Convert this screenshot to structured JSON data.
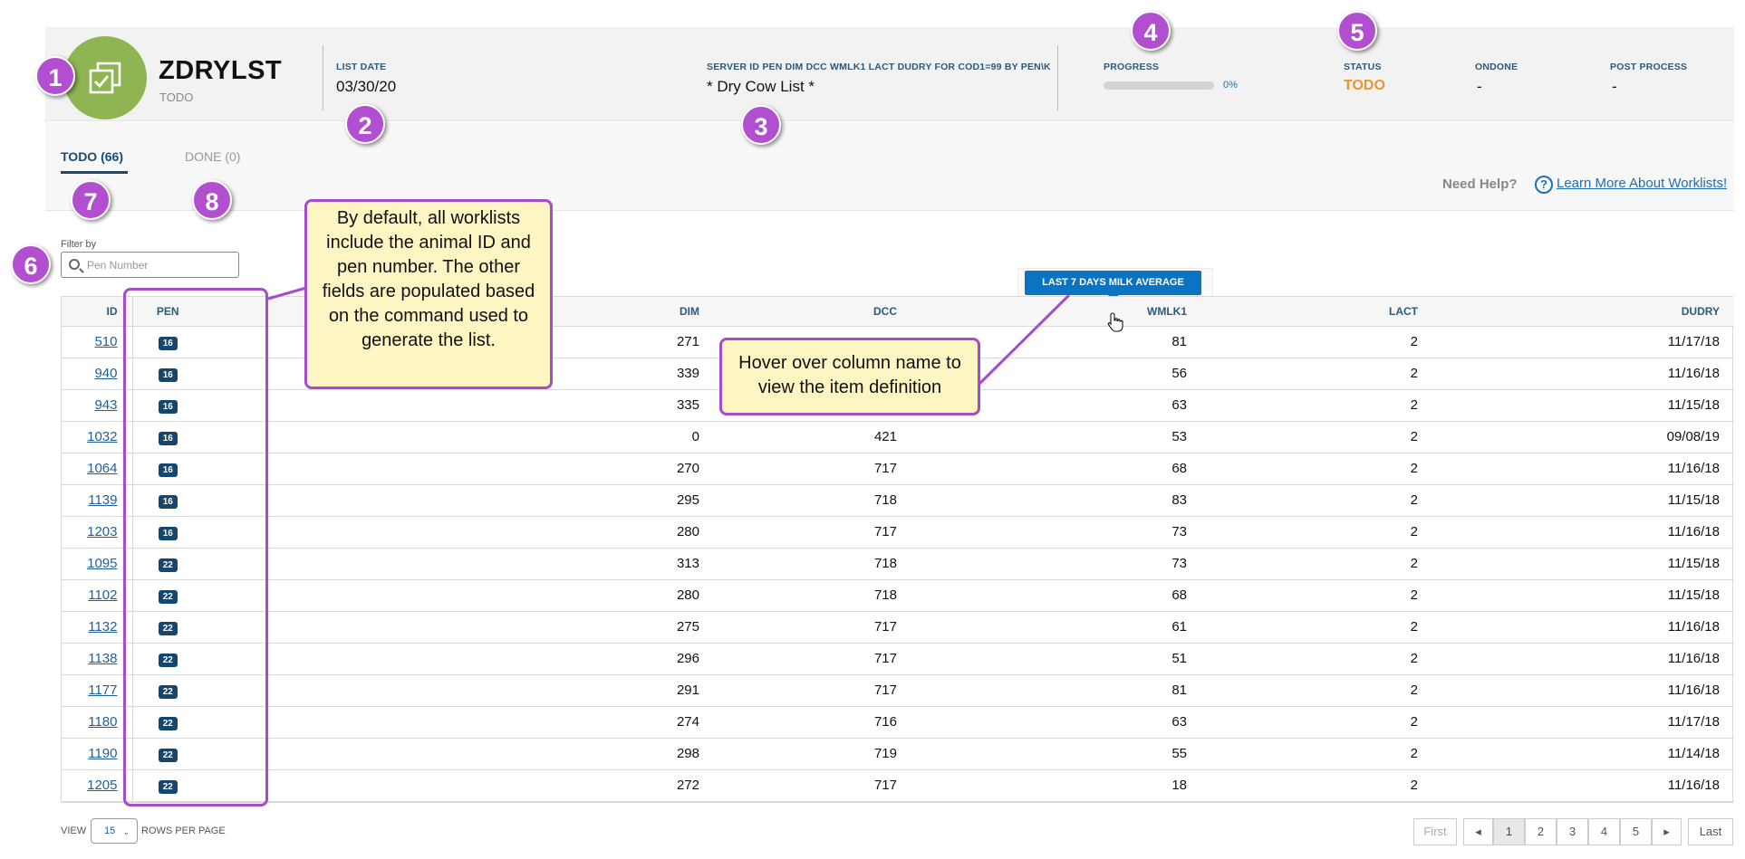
{
  "header": {
    "name": "ZDRYLST",
    "subtitle": "TODO",
    "list_date_label": "LIST DATE",
    "list_date": "03/30/20",
    "command_label": "SERVER ID PEN DIM DCC WMLK1 LACT DUDRY FOR COD1=99 BY PEN\\K",
    "command_value": "* Dry Cow List *",
    "progress_label": "PROGRESS",
    "progress_value": 0,
    "progress_text": "0%",
    "status_label": "STATUS",
    "status_value": "TODO",
    "ondone_label": "ONDONE",
    "ondone_value": "-",
    "post_process_label": "POST PROCESS",
    "post_process_value": "-"
  },
  "tabs": {
    "todo": "TODO (66)",
    "done": "DONE (0)"
  },
  "help": {
    "need_help": "Need Help?",
    "link": "Learn More About Worklists!"
  },
  "filter": {
    "label": "Filter by",
    "placeholder": "Pen Number"
  },
  "table": {
    "columns": [
      "ID",
      "PEN",
      "DIM",
      "DCC",
      "WMLK1",
      "LACT",
      "DUDRY"
    ],
    "tooltip": "LAST 7 DAYS MILK AVERAGE",
    "rows": [
      [
        "510",
        "16",
        "271",
        "",
        "81",
        "2",
        "11/17/18"
      ],
      [
        "940",
        "16",
        "339",
        "",
        "56",
        "2",
        "11/16/18"
      ],
      [
        "943",
        "16",
        "335",
        "",
        "63",
        "2",
        "11/15/18"
      ],
      [
        "1032",
        "16",
        "0",
        "421",
        "53",
        "2",
        "09/08/19"
      ],
      [
        "1064",
        "16",
        "270",
        "717",
        "68",
        "2",
        "11/16/18"
      ],
      [
        "1139",
        "16",
        "295",
        "718",
        "83",
        "2",
        "11/15/18"
      ],
      [
        "1203",
        "16",
        "280",
        "717",
        "73",
        "2",
        "11/16/18"
      ],
      [
        "1095",
        "22",
        "313",
        "718",
        "73",
        "2",
        "11/15/18"
      ],
      [
        "1102",
        "22",
        "280",
        "718",
        "68",
        "2",
        "11/15/18"
      ],
      [
        "1132",
        "22",
        "275",
        "717",
        "61",
        "2",
        "11/16/18"
      ],
      [
        "1138",
        "22",
        "296",
        "717",
        "51",
        "2",
        "11/16/18"
      ],
      [
        "1177",
        "22",
        "291",
        "717",
        "81",
        "2",
        "11/16/18"
      ],
      [
        "1180",
        "22",
        "274",
        "716",
        "63",
        "2",
        "11/17/18"
      ],
      [
        "1190",
        "22",
        "298",
        "719",
        "55",
        "2",
        "11/14/18"
      ],
      [
        "1205",
        "22",
        "272",
        "717",
        "18",
        "2",
        "11/16/18"
      ]
    ]
  },
  "footer": {
    "view": "VIEW",
    "rows_value": "15",
    "rows_per_page": "ROWS PER PAGE",
    "first": "First",
    "prev": "◂",
    "pages": [
      "1",
      "2",
      "3",
      "4",
      "5"
    ],
    "next": "▸",
    "last": "Last"
  },
  "callouts": {
    "markers": [
      "1",
      "2",
      "3",
      "4",
      "5",
      "6",
      "7",
      "8"
    ],
    "note_fields": "By default, all worklists include the animal ID and pen number. The other fields are populated based on the command used to generate the list.",
    "note_hover": "Hover over column name to view the item definition"
  },
  "colors": {
    "accent": "#15466d",
    "link": "#1f5f9a",
    "status_todo": "#e8952e",
    "icon_bg": "#8fb552",
    "callout_marker": "#b24fd1",
    "callout_note_bg": "#fdf6c3",
    "tooltip_bg": "#0a74c2"
  },
  "icons": {
    "app": "copy-check-icon",
    "help": "question-circle-icon",
    "filter": "search-icon",
    "cursor": "hand-pointer-icon"
  }
}
